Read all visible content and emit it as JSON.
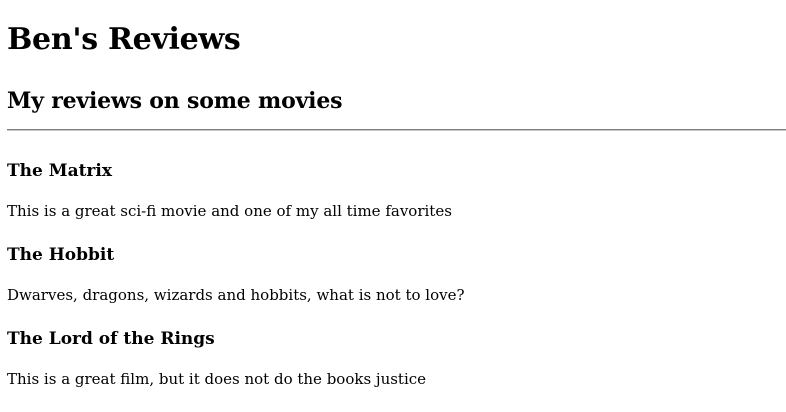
{
  "site": {
    "title": "Ben's Reviews",
    "subtitle": "My reviews on some movies"
  },
  "reviews": [
    {
      "title": "The Matrix",
      "text": "This is a great sci-fi movie and one of my all time favorites"
    },
    {
      "title": "The Hobbit",
      "text": "Dwarves, dragons, wizards and hobbits, what is not to love?"
    },
    {
      "title": "The Lord of the Rings",
      "text": "This is a great film, but it does not do the books justice"
    }
  ]
}
